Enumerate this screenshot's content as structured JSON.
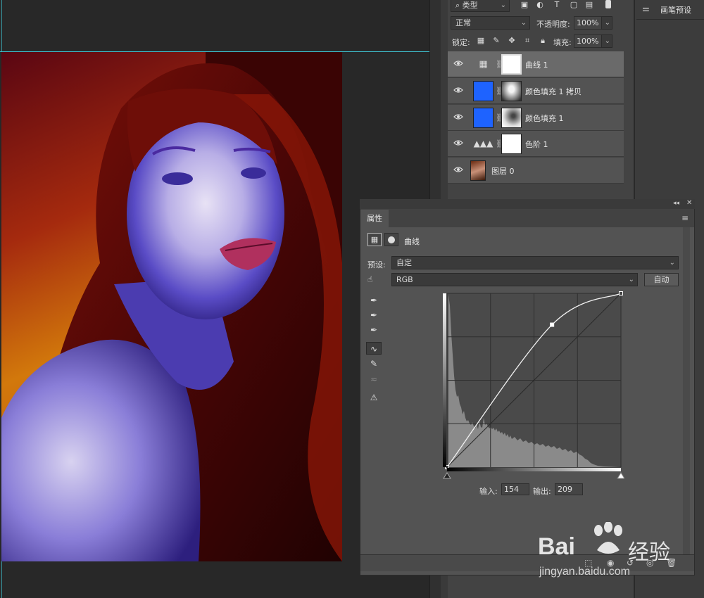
{
  "layers_panel": {
    "filter_kind": "类型",
    "blend_mode": "正常",
    "opacity_label": "不透明度:",
    "opacity_value": "100%",
    "lock_label": "锁定:",
    "fill_label": "填充:",
    "fill_value": "100%",
    "layers": [
      {
        "name": "曲线 1",
        "selected": true
      },
      {
        "name": "颜色填充 1 拷贝",
        "selected": false
      },
      {
        "name": "颜色填充 1",
        "selected": false
      },
      {
        "name": "色阶 1",
        "selected": false
      },
      {
        "name": "图层 0",
        "selected": false
      }
    ]
  },
  "right_panel": {
    "brush_presets_label": "画笔预设"
  },
  "properties_panel": {
    "tab_label": "属性",
    "adjustment_title": "曲线",
    "preset_label": "预设:",
    "preset_value": "自定",
    "channel_value": "RGB",
    "auto_button": "自动",
    "input_label": "输入:",
    "input_value": "154",
    "output_label": "输出:",
    "output_value": "209"
  },
  "curve": {
    "points": [
      [
        0,
        0
      ],
      [
        154,
        209
      ],
      [
        255,
        255
      ]
    ]
  },
  "watermark": {
    "brand": "Bai",
    "brand2": "经验",
    "url": "jingyan.baidu.com"
  },
  "colors": {
    "guide": "#3fc7d6",
    "fill_blue": "#1e63ff",
    "panel_bg": "#535353",
    "selected_layer": "#6a6a6a"
  }
}
